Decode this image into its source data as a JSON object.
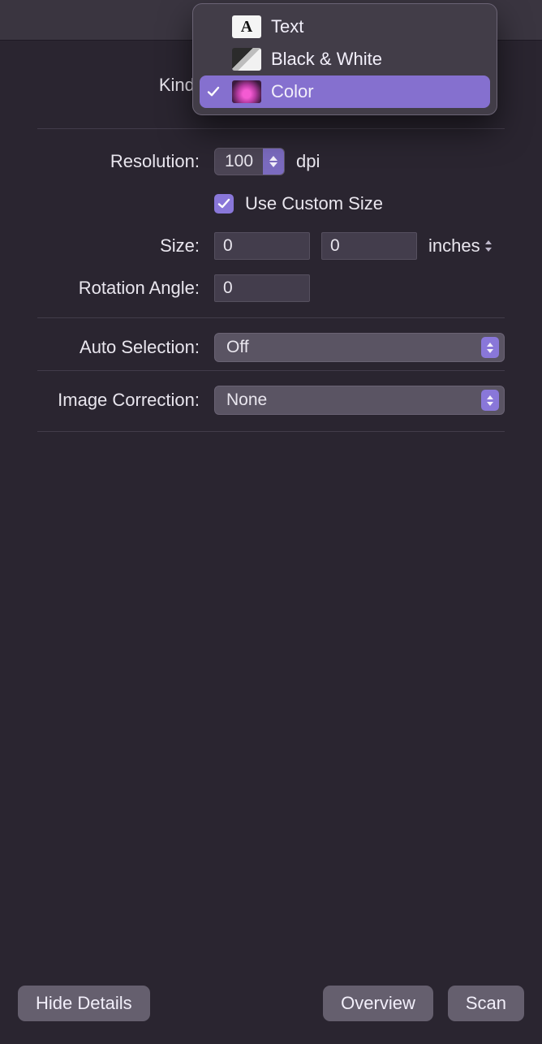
{
  "form": {
    "kind_label": "Kind:",
    "resolution_label": "Resolution:",
    "resolution_value": "100",
    "resolution_unit": "dpi",
    "use_custom_size_label": "Use Custom Size",
    "use_custom_size_checked": true,
    "size_label": "Size:",
    "size_width": "0",
    "size_height": "0",
    "size_unit": "inches",
    "rotation_label": "Rotation Angle:",
    "rotation_value": "0",
    "auto_selection_label": "Auto Selection:",
    "auto_selection_value": "Off",
    "image_correction_label": "Image Correction:",
    "image_correction_value": "None"
  },
  "dropdown": {
    "items": [
      {
        "icon": "text",
        "label": "Text",
        "selected": false
      },
      {
        "icon": "bw",
        "label": "Black & White",
        "selected": false
      },
      {
        "icon": "color",
        "label": "Color",
        "selected": true
      }
    ]
  },
  "footer": {
    "hide_details": "Hide Details",
    "overview": "Overview",
    "scan": "Scan"
  },
  "colors": {
    "accent": "#8977d9",
    "panel": "#2a2530"
  }
}
